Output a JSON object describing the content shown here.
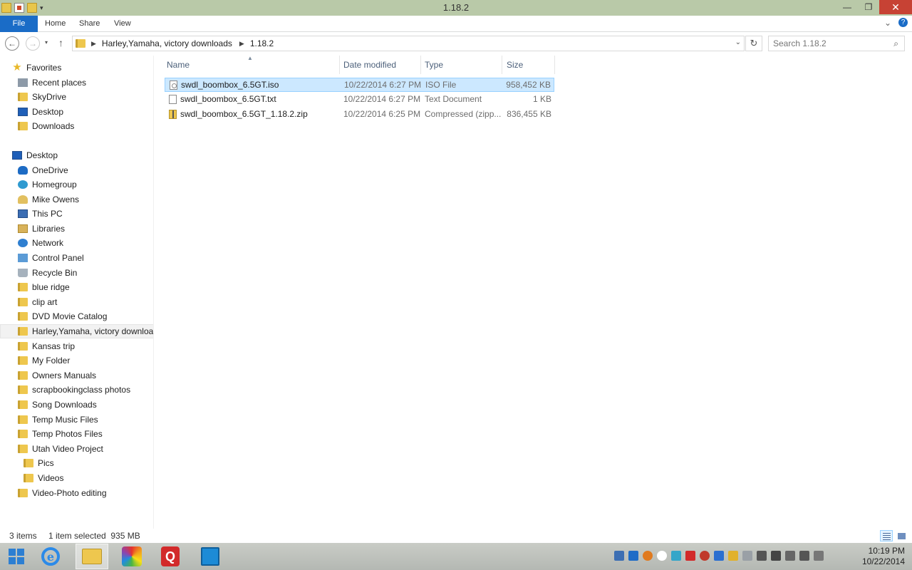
{
  "window": {
    "title": "1.18.2",
    "minimize_label": "—",
    "maximize_label": "❐",
    "close_label": "✕"
  },
  "ribbon": {
    "tabs": [
      "File",
      "Home",
      "Share",
      "View"
    ]
  },
  "address": {
    "back_icon": "back-arrow-icon",
    "forward_icon": "forward-arrow-icon",
    "up_icon": "up-arrow-icon",
    "breadcrumb": [
      "Harley,Yamaha, victory downloads",
      "1.18.2"
    ],
    "search_placeholder": "Search 1.18.2"
  },
  "navpane": {
    "favorites_header": "Favorites",
    "favorites": [
      "Recent places",
      "SkyDrive",
      "Desktop",
      "Downloads"
    ],
    "desktop_header": "Desktop",
    "desktop_items": [
      "OneDrive",
      "Homegroup",
      "Mike Owens",
      "This PC",
      "Libraries",
      "Network",
      "Control Panel",
      "Recycle Bin",
      "blue ridge",
      "clip art",
      "DVD Movie Catalog",
      "Harley,Yamaha, victory downloads",
      "Kansas trip",
      "My Folder",
      "Owners Manuals",
      "scrapbookingclass photos",
      "Song Downloads",
      "Temp Music Files",
      "Temp Photos Files",
      "Utah Video Project"
    ],
    "utah_children": [
      "Pics",
      "Videos"
    ],
    "last_item": "Video-Photo editing",
    "selected_item": "Harley,Yamaha, victory downloads"
  },
  "columns": {
    "name": "Name",
    "date": "Date modified",
    "type": "Type",
    "size": "Size"
  },
  "files": [
    {
      "name": "swdl_boombox_6.5GT.iso",
      "date": "10/22/2014 6:27 PM",
      "type": "ISO File",
      "size": "958,452 KB",
      "selected": true
    },
    {
      "name": "swdl_boombox_6.5GT.txt",
      "date": "10/22/2014 6:27 PM",
      "type": "Text Document",
      "size": "1 KB",
      "selected": false
    },
    {
      "name": "swdl_boombox_6.5GT_1.18.2.zip",
      "date": "10/22/2014 6:25 PM",
      "type": "Compressed (zipp...",
      "size": "836,455 KB",
      "selected": false
    }
  ],
  "status": {
    "item_count": "3 items",
    "selection": "1 item selected  935 MB"
  },
  "taskbar": {
    "time": "10:19 PM",
    "date": "10/22/2014"
  },
  "colors": {
    "titlebar": "#b9c9a8",
    "file_tab": "#1a6cc7",
    "close_button": "#c74234",
    "selection": "#cce8ff"
  }
}
